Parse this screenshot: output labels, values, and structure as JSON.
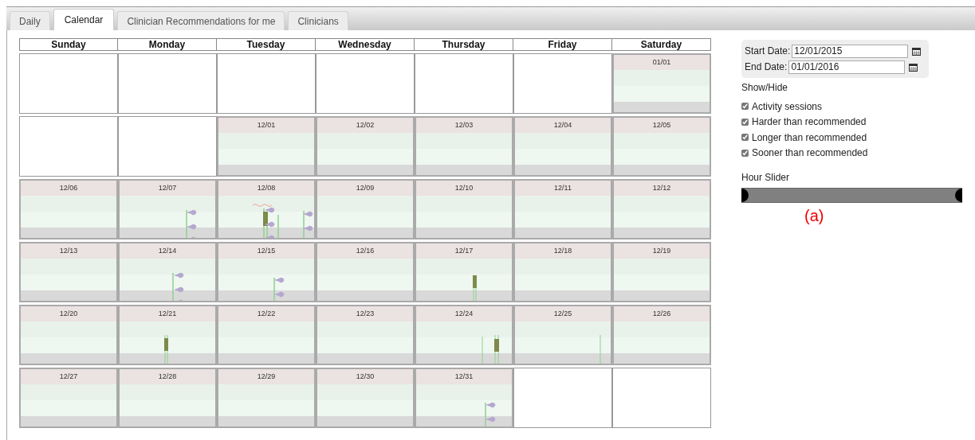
{
  "tabs": [
    {
      "label": "Daily",
      "selected": false
    },
    {
      "label": "Calendar",
      "selected": true
    },
    {
      "label": "Clinician Recommendations for me",
      "selected": false
    },
    {
      "label": "Clinicians",
      "selected": false
    }
  ],
  "calendar": {
    "weekdays": [
      "Sunday",
      "Monday",
      "Tuesday",
      "Wednesday",
      "Thursday",
      "Friday",
      "Saturday"
    ],
    "weeks": [
      [
        {
          "kind": "blank"
        },
        {
          "kind": "blank"
        },
        {
          "kind": "blank"
        },
        {
          "kind": "blank"
        },
        {
          "kind": "blank"
        },
        {
          "kind": "blank"
        },
        {
          "kind": "day",
          "date": "01/01",
          "activity": false
        }
      ],
      [
        {
          "kind": "blank"
        },
        {
          "kind": "blank"
        },
        {
          "kind": "day",
          "date": "12/01",
          "activity": false
        },
        {
          "kind": "day",
          "date": "12/02",
          "activity": false
        },
        {
          "kind": "day",
          "date": "12/03",
          "activity": false
        },
        {
          "kind": "day",
          "date": "12/04",
          "activity": false
        },
        {
          "kind": "day",
          "date": "12/05",
          "activity": false
        }
      ],
      [
        {
          "kind": "day",
          "date": "12/06",
          "activity": false
        },
        {
          "kind": "day",
          "date": "12/07",
          "activity": true
        },
        {
          "kind": "day",
          "date": "12/08",
          "activity": true
        },
        {
          "kind": "day",
          "date": "12/09",
          "activity": false
        },
        {
          "kind": "day",
          "date": "12/10",
          "activity": false
        },
        {
          "kind": "day",
          "date": "12/11",
          "activity": false
        },
        {
          "kind": "day",
          "date": "12/12",
          "activity": false
        }
      ],
      [
        {
          "kind": "day",
          "date": "12/13",
          "activity": false
        },
        {
          "kind": "day",
          "date": "12/14",
          "activity": true
        },
        {
          "kind": "day",
          "date": "12/15",
          "activity": true
        },
        {
          "kind": "day",
          "date": "12/16",
          "activity": false
        },
        {
          "kind": "day",
          "date": "12/17",
          "activity": true
        },
        {
          "kind": "day",
          "date": "12/18",
          "activity": false
        },
        {
          "kind": "day",
          "date": "12/19",
          "activity": false
        }
      ],
      [
        {
          "kind": "day",
          "date": "12/20",
          "activity": false
        },
        {
          "kind": "day",
          "date": "12/21",
          "activity": true
        },
        {
          "kind": "day",
          "date": "12/22",
          "activity": false
        },
        {
          "kind": "day",
          "date": "12/23",
          "activity": false
        },
        {
          "kind": "day",
          "date": "12/24",
          "activity": true
        },
        {
          "kind": "day",
          "date": "12/25",
          "activity": true
        },
        {
          "kind": "day",
          "date": "12/26",
          "activity": false
        }
      ],
      [
        {
          "kind": "day",
          "date": "12/27",
          "activity": false
        },
        {
          "kind": "day",
          "date": "12/28",
          "activity": false
        },
        {
          "kind": "day",
          "date": "12/29",
          "activity": false
        },
        {
          "kind": "day",
          "date": "12/30",
          "activity": false
        },
        {
          "kind": "day",
          "date": "12/31",
          "activity": true
        },
        {
          "kind": "blank"
        },
        {
          "kind": "blank"
        }
      ]
    ]
  },
  "date_range": {
    "start_label": "Start Date:",
    "start_value": "12/01/2015",
    "end_label": "End Date:",
    "end_value": "01/01/2016"
  },
  "show_hide": {
    "title": "Show/Hide",
    "options": [
      {
        "label": "Activity sessions",
        "checked": true
      },
      {
        "label": "Harder than recommended",
        "checked": true
      },
      {
        "label": "Longer than recommended",
        "checked": true
      },
      {
        "label": "Sooner than recommended",
        "checked": true
      }
    ]
  },
  "hour_slider": {
    "label": "Hour Slider",
    "level": 1
  },
  "annotation": "(a)"
}
